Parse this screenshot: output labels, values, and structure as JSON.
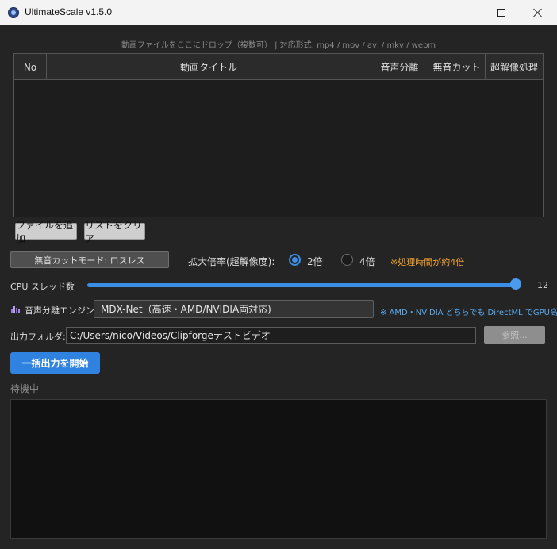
{
  "window": {
    "title": "UltimateScale v1.5.0"
  },
  "drop_hint": "動画ファイルをここにドロップ（複数可） | 対応形式: mp4 / mov / avi / mkv / webm",
  "table": {
    "headers": [
      "No",
      "動画タイトル",
      "音声分離",
      "無音カット",
      "超解像処理"
    ],
    "rows": []
  },
  "file_buttons": {
    "add": "ファイルを追加",
    "clear": "リストをクリア"
  },
  "silent_mode_button": "無音カットモード: ロスレス",
  "scale": {
    "label": "拡大倍率(超解像度):",
    "options": [
      {
        "label": "2倍",
        "selected": true
      },
      {
        "label": "4倍",
        "selected": false
      }
    ],
    "warning": "※処理時間が約4倍"
  },
  "cpu_threads": {
    "label": "CPU スレッド数",
    "value": "12",
    "fraction": 1.0
  },
  "engine": {
    "icon": "audio-separation-icon",
    "label": "音声分離エンジン:",
    "selected": "MDX-Net（高速・AMD/NVIDIA両対応)",
    "note": "※ AMD・NVIDIA どちらでも DirectML でGPU高速"
  },
  "output": {
    "label": "出力フォルダ:",
    "path": "C:/Users/nico/Videos/Clipforgeテストビデオ",
    "browse": "参照..."
  },
  "start_button": "一括出力を開始",
  "status": "待機中",
  "colors": {
    "accent": "#2f82df",
    "warning": "#f0a032",
    "info": "#5aaaf0"
  }
}
